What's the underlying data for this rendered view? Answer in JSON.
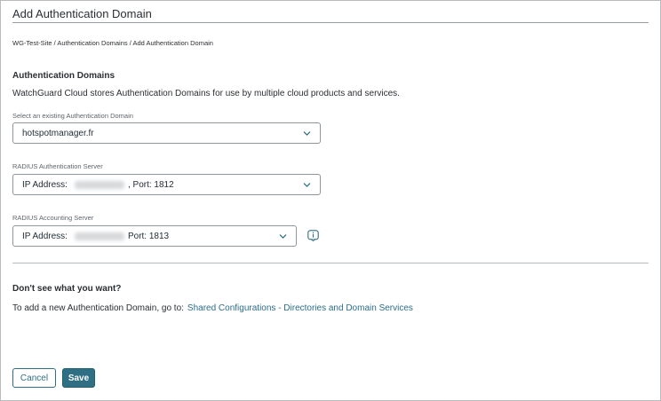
{
  "page": {
    "title": "Add Authentication Domain",
    "breadcrumb": "WG-Test-Site / Authentication Domains / Add Authentication Domain"
  },
  "section": {
    "heading": "Authentication Domains",
    "description": "WatchGuard Cloud stores Authentication Domains for use by multiple cloud products and services."
  },
  "fields": {
    "domain": {
      "label": "Select an existing Authentication Domain",
      "value": "hotspotmanager.fr"
    },
    "auth_server": {
      "label": "RADIUS Authentication Server",
      "ip_label": "IP Address:",
      "port_text": ",  Port: 1812"
    },
    "acct_server": {
      "label": "RADIUS Accounting Server",
      "ip_label": "IP Address:",
      "port_text": "Port: 1813"
    }
  },
  "hint": {
    "heading": "Don't see what you want?",
    "text": "To add a new Authentication Domain, go to:",
    "link": "Shared Configurations - Directories and Domain Services"
  },
  "buttons": {
    "cancel": "Cancel",
    "save": "Save"
  },
  "colors": {
    "accent": "#2e6f84",
    "link": "#2a6e8a",
    "border": "#8f969c"
  },
  "icons": {
    "dropdown": "chevron-down-icon",
    "info": "info-icon"
  }
}
